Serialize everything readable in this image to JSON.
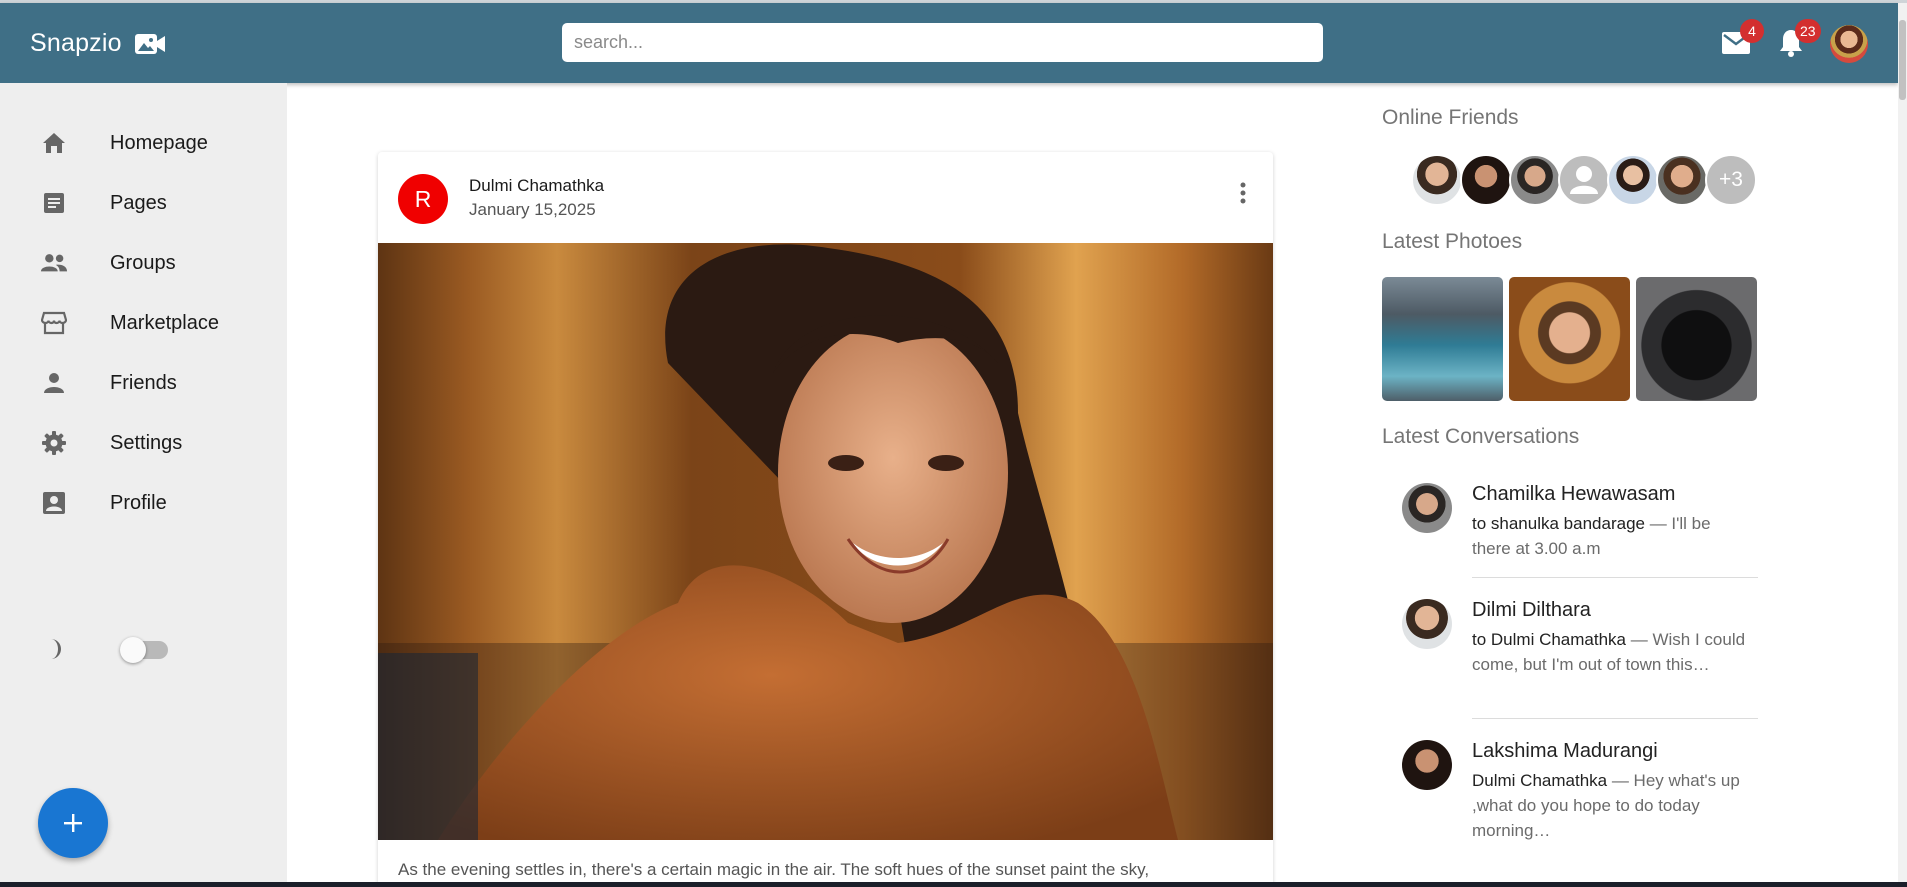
{
  "app": {
    "brand": "Snapzio",
    "brand_icon": "video-camera-photo-icon",
    "accent": "#3f6f86"
  },
  "header": {
    "search_placeholder": "search...",
    "mail_badge": "4",
    "notifications_badge": "23"
  },
  "sidebar": {
    "items": [
      {
        "label": "Homepage",
        "icon": "home-icon"
      },
      {
        "label": "Pages",
        "icon": "article-icon"
      },
      {
        "label": "Groups",
        "icon": "groups-icon"
      },
      {
        "label": "Marketplace",
        "icon": "storefront-icon"
      },
      {
        "label": "Friends",
        "icon": "person-icon"
      },
      {
        "label": "Settings",
        "icon": "gear-icon"
      },
      {
        "label": "Profile",
        "icon": "account-box-icon"
      }
    ],
    "dark_mode": false
  },
  "post": {
    "avatar_letter": "R",
    "author": "Dulmi Chamathka",
    "date": "January 15,2025",
    "caption": "As the evening settles in, there's a certain magic in the air. The soft hues of the sunset paint the sky,"
  },
  "right": {
    "online_title": "Online Friends",
    "online_more": "+3",
    "photos_title": "Latest Photoes",
    "conversations_title": "Latest Conversations",
    "conversations": [
      {
        "name": "Chamilka Hewawasam",
        "to": "to shanulka bandarage",
        "text": " — I'll be there at 3.00 a.m"
      },
      {
        "name": "Dilmi Dilthara",
        "to": "to Dulmi Chamathka",
        "text": " — Wish I could come, but I'm out of town this…"
      },
      {
        "name": "Lakshima Madurangi",
        "to": "Dulmi Chamathka",
        "text": " — Hey what's up ,what do you hope to do today morning…"
      }
    ]
  }
}
